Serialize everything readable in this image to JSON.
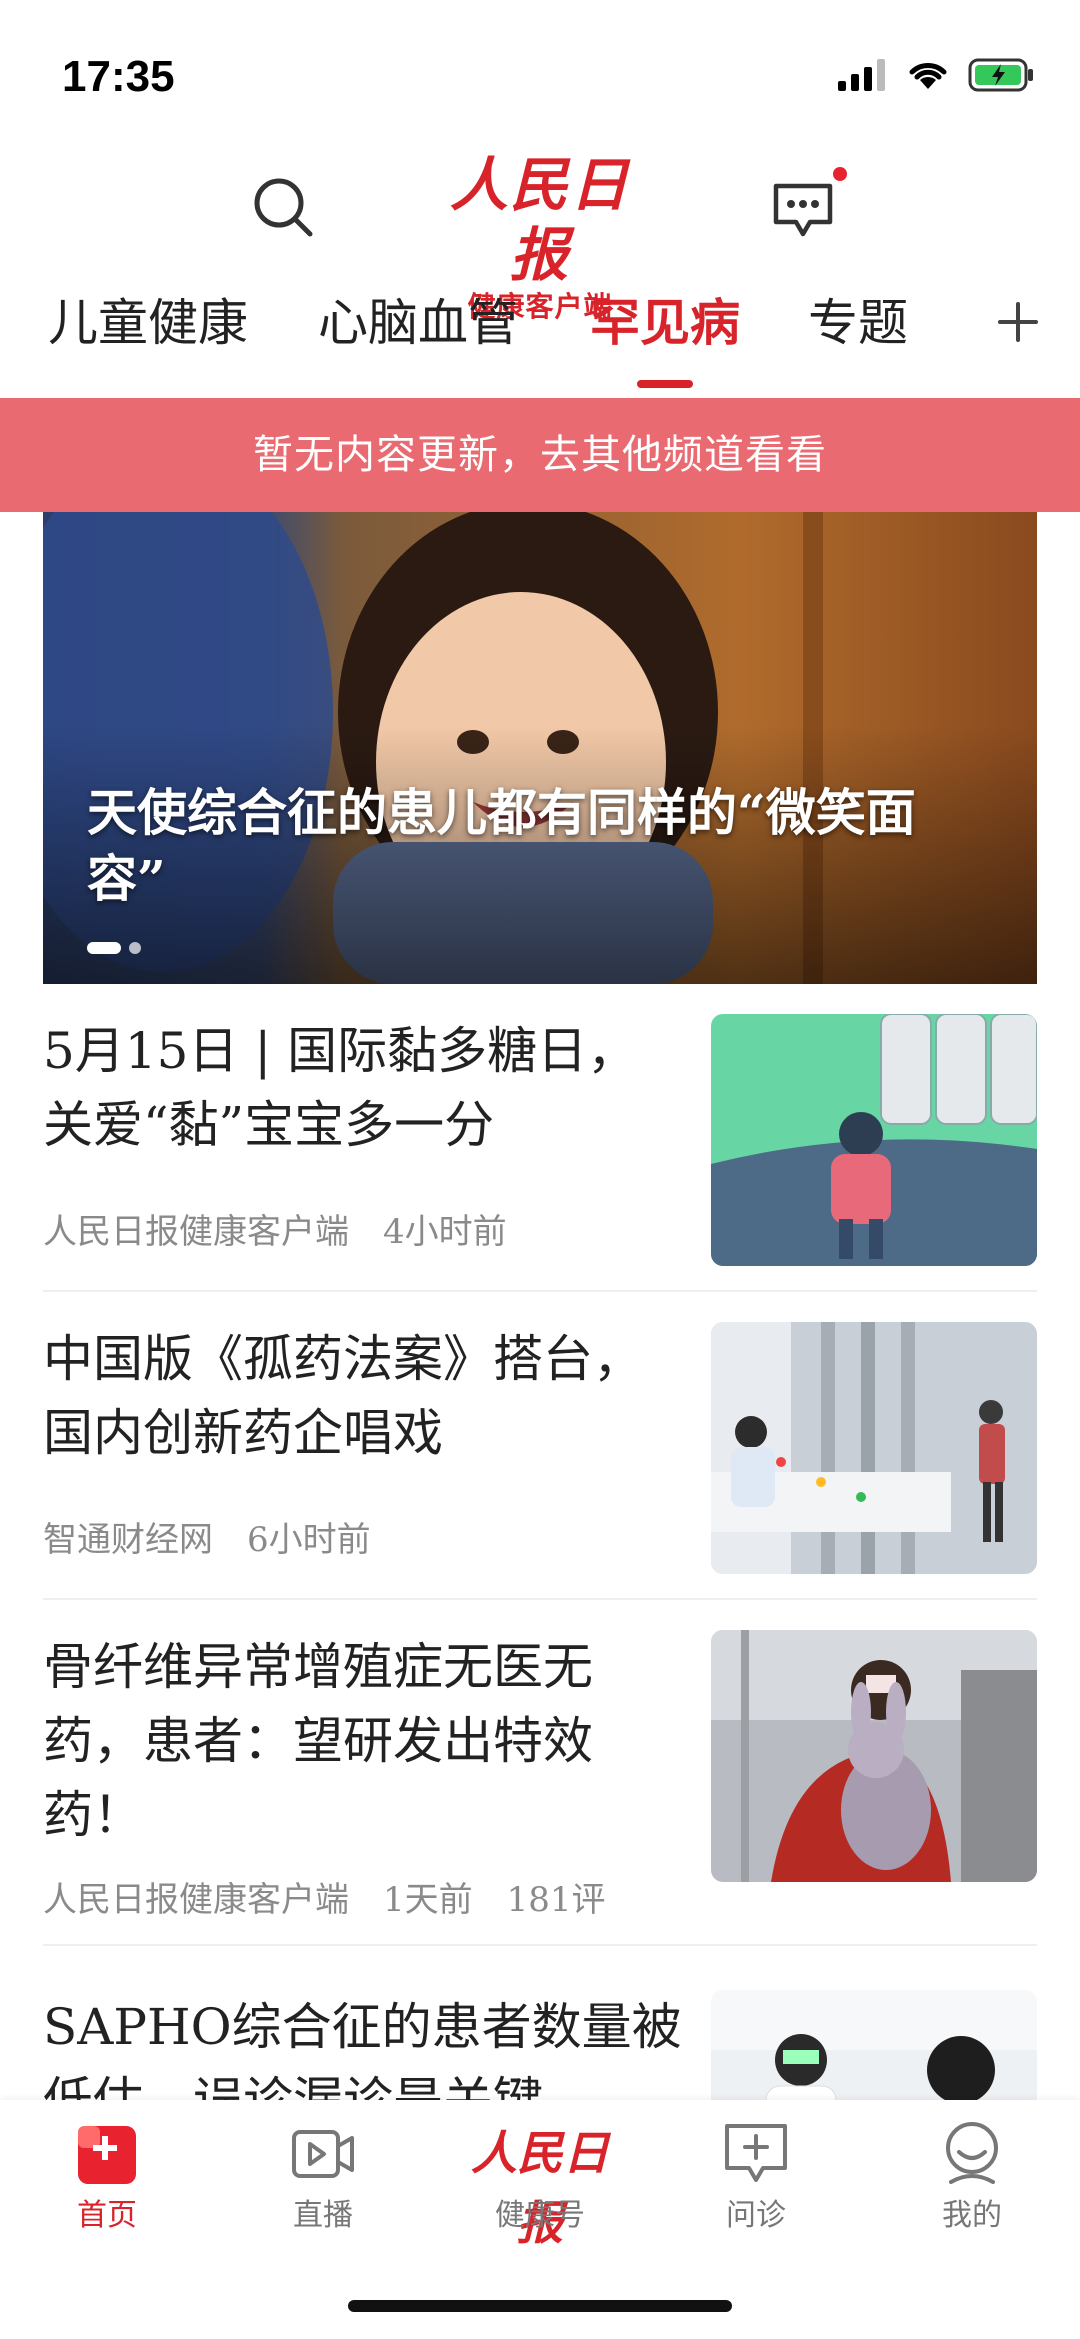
{
  "status_bar": {
    "time": "17:35"
  },
  "header": {
    "logo_main": "人民日报",
    "logo_sub": "健康客户端"
  },
  "tabs": [
    {
      "label": "儿童健康",
      "active": false
    },
    {
      "label": "心脑血管",
      "active": false
    },
    {
      "label": "罕见病",
      "active": true
    },
    {
      "label": "专题",
      "active": false
    }
  ],
  "notice": {
    "text": "暂无内容更新，去其他频道看看"
  },
  "banner": {
    "title": "天使综合征的患儿都有同样的“微笑面容”",
    "slide_count": 2,
    "active_slide": 1
  },
  "news": [
    {
      "title": "5月15日 | 国际黏多糖日，关爱“黏”宝宝多一分",
      "source": "人民日报健康客户端",
      "time": "4小时前",
      "comments": ""
    },
    {
      "title": "中国版《孤药法案》搭台，国内创新药企唱戏",
      "source": "智通财经网",
      "time": "6小时前",
      "comments": ""
    },
    {
      "title": "骨纤维异常增殖症无医无药，患者：望研发出特效药！",
      "source": "人民日报健康客户端",
      "time": "1天前",
      "comments": "181评"
    },
    {
      "title": "SAPHO综合征的患者数量被低估，误诊漏诊是关键",
      "source": "",
      "time": "",
      "comments": ""
    }
  ],
  "bottom_nav": [
    {
      "label": "首页",
      "icon": "home-icon",
      "active": true
    },
    {
      "label": "直播",
      "icon": "live-video-icon",
      "active": false
    },
    {
      "label": "健康号",
      "icon": "brand-logo",
      "logo_text": "人民日报",
      "active": false
    },
    {
      "label": "问诊",
      "icon": "consult-chat-icon",
      "active": false
    },
    {
      "label": "我的",
      "icon": "profile-icon",
      "active": false
    }
  ],
  "colors": {
    "brand_red": "#d8232a",
    "notice_bg": "#e96a71",
    "meta_gray": "#8a8a8a"
  }
}
